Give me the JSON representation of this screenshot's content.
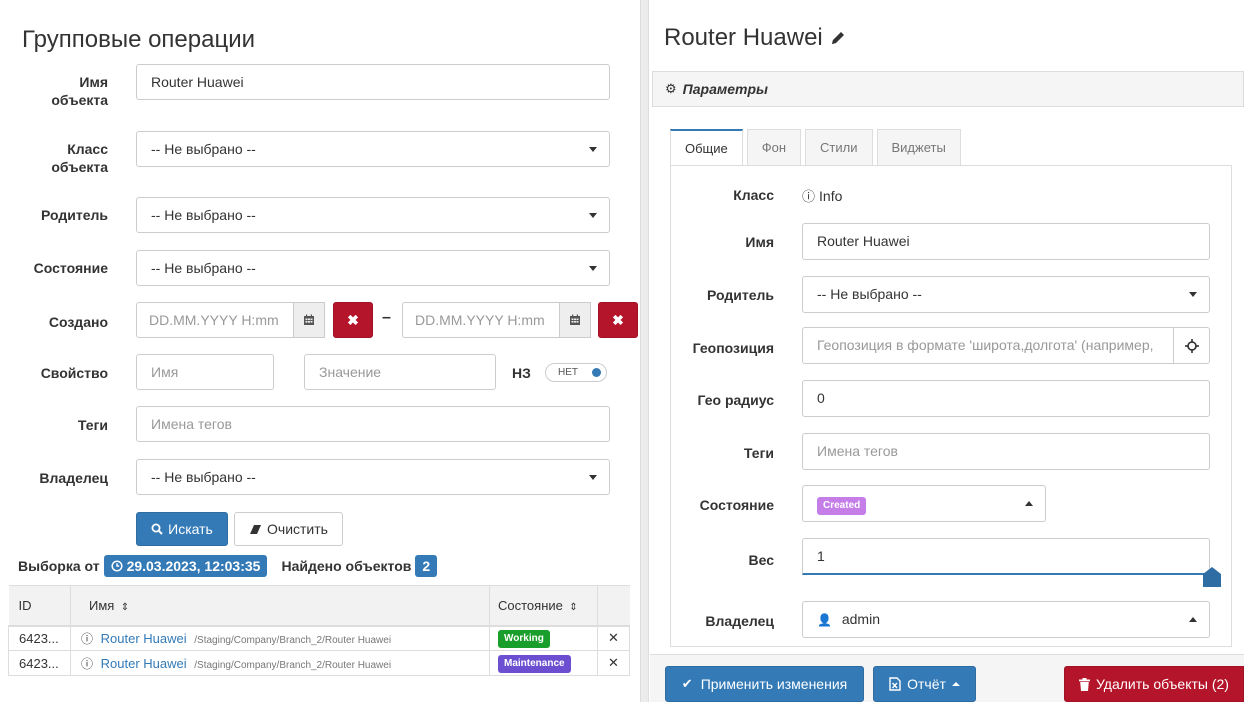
{
  "left": {
    "title": "Групповые операции",
    "fields": {
      "name_label": "Имя объекта",
      "name_value": "Router Huawei",
      "class_label": "Класс объекта",
      "class_value": "-- Не выбрано --",
      "parent_label": "Родитель",
      "parent_value": "-- Не выбрано --",
      "state_label": "Состояние",
      "state_value": "-- Не выбрано --",
      "created_label": "Создано",
      "date_placeholder": "DD.MM.YYYY H:mm",
      "dash": "–",
      "property_label": "Свойство",
      "property_name_placeholder": "Имя",
      "property_value_placeholder": "Значение",
      "nz_label": "НЗ",
      "nz_toggle": "НЕТ",
      "tags_label": "Теги",
      "tags_placeholder": "Имена тегов",
      "owner_label": "Владелец",
      "owner_value": "-- Не выбрано --"
    },
    "search_button": "Искать",
    "clear_button": "Очистить",
    "selection_label": "Выборка от",
    "selection_date": "29.03.2023, 12:03:35",
    "found_label": "Найдено объектов",
    "found_count": "2",
    "table": {
      "headers": [
        "ID",
        "Имя",
        "Состояние"
      ],
      "rows": [
        {
          "id": "6423...",
          "name": "Router Huawei",
          "path": "/Staging/Company/Branch_2/Router Huawei",
          "status": "Working",
          "status_color": "#1a9e2b"
        },
        {
          "id": "6423...",
          "name": "Router Huawei",
          "path": "/Staging/Company/Branch_2/Router Huawei",
          "status": "Maintenance",
          "status_color": "#6c4fd1"
        }
      ]
    }
  },
  "right": {
    "title": "Router Huawei",
    "panel_title": "Параметры",
    "tabs": [
      "Общие",
      "Фон",
      "Стили",
      "Виджеты"
    ],
    "active_tab": 0,
    "fields": {
      "class_label": "Класс",
      "class_value": "Info",
      "name_label": "Имя",
      "name_value": "Router Huawei",
      "parent_label": "Родитель",
      "parent_value": "-- Не выбрано --",
      "geo_label": "Геопозиция",
      "geo_placeholder": "Геопозиция в формате 'широта,долгота' (например,",
      "geo_radius_label": "Гео радиус",
      "geo_radius_value": "0",
      "tags_label": "Теги",
      "tags_placeholder": "Имена тегов",
      "state_label": "Состояние",
      "state_badge": "Created",
      "state_badge_color": "#c57de8",
      "weight_label": "Вес",
      "weight_value": "1",
      "owner_label": "Владелец",
      "owner_value": "admin"
    },
    "apply_button": "Применить изменения",
    "report_button": "Отчёт",
    "delete_button": "Удалить объекты (2)"
  },
  "colors": {
    "primary": "#337ab7",
    "danger": "#b5152b"
  }
}
